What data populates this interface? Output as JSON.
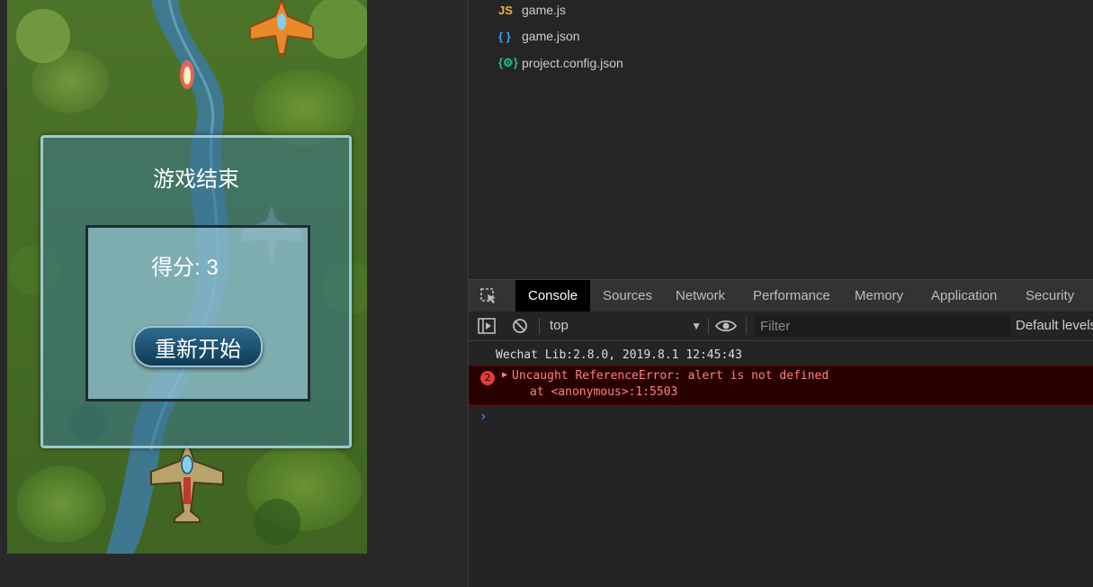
{
  "game": {
    "overlay_title": "游戏结束",
    "score_label": "得分: 3",
    "restart_label": "重新开始"
  },
  "file_tree": {
    "files": [
      {
        "icon": "js-file-icon",
        "icon_text": "JS",
        "icon_color": "#e8b83b",
        "name": "game.js"
      },
      {
        "icon": "json-file-icon",
        "icon_text": "{ }",
        "icon_color": "#3aa6e6",
        "name": "game.json"
      },
      {
        "icon": "config-file-icon",
        "icon_text": "{⚙}",
        "icon_color": "#20c080",
        "name": "project.config.json"
      }
    ]
  },
  "devtools": {
    "tabs": [
      "Console",
      "Sources",
      "Network",
      "Performance",
      "Memory",
      "Application",
      "Security"
    ],
    "active_tab": "Console",
    "context": "top",
    "filter_placeholder": "Filter",
    "levels_label": "Default levels",
    "console": {
      "info_line": "Wechat Lib:2.8.0, 2019.8.1 12:45:43",
      "error_count": "2",
      "error_message": "Uncaught ReferenceError: alert is not defined",
      "error_stack": "at <anonymous>:1:5503",
      "prompt": "›"
    }
  },
  "colors": {
    "error_bg": "#290000",
    "error_text": "#ff8080",
    "tab_active_bg": "#000000",
    "panel_bg": "#242424"
  }
}
